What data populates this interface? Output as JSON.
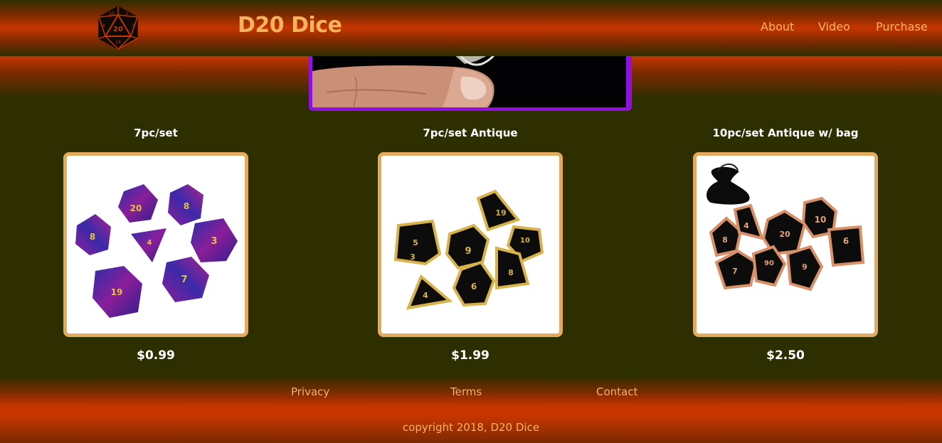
{
  "header": {
    "logo_icon": "d20-icon",
    "title": "D20 Dice",
    "nav": [
      {
        "label": "About"
      },
      {
        "label": "Video"
      },
      {
        "label": "Purchase"
      }
    ]
  },
  "products": [
    {
      "name": "7pc/set",
      "price": "$0.99",
      "image": "purple-blue-dice-image"
    },
    {
      "name": "7pc/set Antique",
      "price": "$1.99",
      "image": "gold-black-metal-dice-image"
    },
    {
      "name": "10pc/set Antique w/ bag",
      "price": "$2.50",
      "image": "copper-black-metal-dice-with-bag-image"
    }
  ],
  "footer": {
    "links": [
      {
        "label": "Privacy"
      },
      {
        "label": "Terms"
      },
      {
        "label": "Contact"
      }
    ],
    "copyright": "copyright 2018, D20 Dice"
  },
  "colors": {
    "accent_orange": "#c63500",
    "background": "#2d2f00",
    "link_text": "#f7b35f",
    "frame_border": "#e2aa5c",
    "video_border": "#9010e0"
  }
}
